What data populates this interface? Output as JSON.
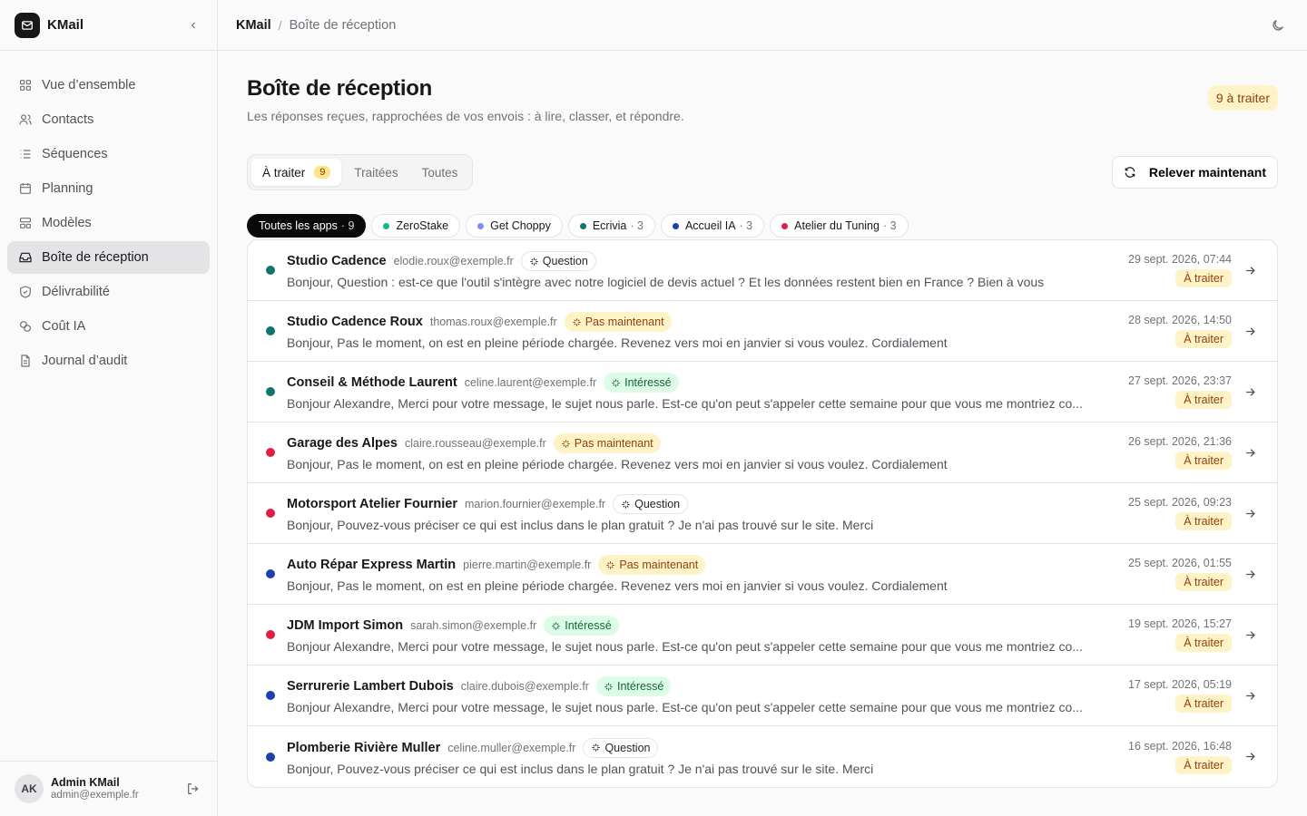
{
  "app": {
    "name": "KMail"
  },
  "sidebar": {
    "items": [
      {
        "label": "Vue d’ensemble",
        "icon": "grid-icon"
      },
      {
        "label": "Contacts",
        "icon": "users-icon"
      },
      {
        "label": "Séquences",
        "icon": "list-icon"
      },
      {
        "label": "Planning",
        "icon": "calendar-icon"
      },
      {
        "label": "Modèles",
        "icon": "template-icon"
      },
      {
        "label": "Boîte de réception",
        "icon": "inbox-icon",
        "active": true
      },
      {
        "label": "Délivrabilité",
        "icon": "shield-icon"
      },
      {
        "label": "Coût IA",
        "icon": "coins-icon"
      },
      {
        "label": "Journal d’audit",
        "icon": "file-icon"
      }
    ],
    "user": {
      "initials": "AK",
      "name": "Admin KMail",
      "email": "admin@exemple.fr"
    }
  },
  "breadcrumb": {
    "root": "KMail",
    "separator": "/",
    "current": "Boîte de réception"
  },
  "header": {
    "title": "Boîte de réception",
    "subtitle": "Les réponses reçues, rapprochées de vos envois : à lire, classer, et répondre.",
    "badge": "9 à traiter"
  },
  "tabs": [
    {
      "label": "À traiter",
      "count": "9",
      "active": true
    },
    {
      "label": "Traitées"
    },
    {
      "label": "Toutes"
    }
  ],
  "refresh_label": "Relever maintenant",
  "filters": [
    {
      "label": "Toutes les apps",
      "count": "· 9",
      "active": true
    },
    {
      "label": "ZeroStake",
      "count": "",
      "color": "#10b981"
    },
    {
      "label": "Get Choppy",
      "count": "",
      "color": "#818cf8"
    },
    {
      "label": "Ecrivia",
      "count": "· 3",
      "color": "#0f766e"
    },
    {
      "label": "Accueil IA",
      "count": "· 3",
      "color": "#1e40af"
    },
    {
      "label": "Atelier du Tuning",
      "count": "· 3",
      "color": "#e11d48"
    }
  ],
  "colors": {
    "teal": "#0f766e",
    "red": "#e11d48",
    "blue": "#1e40af"
  },
  "messages": [
    {
      "sender": "Studio Cadence",
      "email": "elodie.roux@exemple.fr",
      "tag": "Question",
      "tag_type": "question",
      "preview": "Bonjour, Question : est-ce que l'outil s'intègre avec notre logiciel de devis actuel ? Et les données restent bien en France ? Bien à vous",
      "date": "29 sept. 2026, 07:44",
      "status": "À traiter",
      "dot": "#0f766e"
    },
    {
      "sender": "Studio Cadence Roux",
      "email": "thomas.roux@exemple.fr",
      "tag": "Pas maintenant",
      "tag_type": "later",
      "preview": "Bonjour, Pas le moment, on est en pleine période chargée. Revenez vers moi en janvier si vous voulez. Cordialement",
      "date": "28 sept. 2026, 14:50",
      "status": "À traiter",
      "dot": "#0f766e"
    },
    {
      "sender": "Conseil & Méthode Laurent",
      "email": "celine.laurent@exemple.fr",
      "tag": "Intéressé",
      "tag_type": "interest",
      "preview": "Bonjour Alexandre, Merci pour votre message, le sujet nous parle. Est-ce qu'on peut s'appeler cette semaine pour que vous me montriez co...",
      "date": "27 sept. 2026, 23:37",
      "status": "À traiter",
      "dot": "#0f766e"
    },
    {
      "sender": "Garage des Alpes",
      "email": "claire.rousseau@exemple.fr",
      "tag": "Pas maintenant",
      "tag_type": "later",
      "preview": "Bonjour, Pas le moment, on est en pleine période chargée. Revenez vers moi en janvier si vous voulez. Cordialement",
      "date": "26 sept. 2026, 21:36",
      "status": "À traiter",
      "dot": "#e11d48"
    },
    {
      "sender": "Motorsport Atelier Fournier",
      "email": "marion.fournier@exemple.fr",
      "tag": "Question",
      "tag_type": "question",
      "preview": "Bonjour, Pouvez-vous préciser ce qui est inclus dans le plan gratuit ? Je n'ai pas trouvé sur le site. Merci",
      "date": "25 sept. 2026, 09:23",
      "status": "À traiter",
      "dot": "#e11d48"
    },
    {
      "sender": "Auto Répar Express Martin",
      "email": "pierre.martin@exemple.fr",
      "tag": "Pas maintenant",
      "tag_type": "later",
      "preview": "Bonjour, Pas le moment, on est en pleine période chargée. Revenez vers moi en janvier si vous voulez. Cordialement",
      "date": "25 sept. 2026, 01:55",
      "status": "À traiter",
      "dot": "#1e40af"
    },
    {
      "sender": "JDM Import Simon",
      "email": "sarah.simon@exemple.fr",
      "tag": "Intéressé",
      "tag_type": "interest",
      "preview": "Bonjour Alexandre, Merci pour votre message, le sujet nous parle. Est-ce qu'on peut s'appeler cette semaine pour que vous me montriez co...",
      "date": "19 sept. 2026, 15:27",
      "status": "À traiter",
      "dot": "#e11d48"
    },
    {
      "sender": "Serrurerie Lambert Dubois",
      "email": "claire.dubois@exemple.fr",
      "tag": "Intéressé",
      "tag_type": "interest",
      "preview": "Bonjour Alexandre, Merci pour votre message, le sujet nous parle. Est-ce qu'on peut s'appeler cette semaine pour que vous me montriez co...",
      "date": "17 sept. 2026, 05:19",
      "status": "À traiter",
      "dot": "#1e40af"
    },
    {
      "sender": "Plomberie Rivière Muller",
      "email": "celine.muller@exemple.fr",
      "tag": "Question",
      "tag_type": "question",
      "preview": "Bonjour, Pouvez-vous préciser ce qui est inclus dans le plan gratuit ? Je n'ai pas trouvé sur le site. Merci",
      "date": "16 sept. 2026, 16:48",
      "status": "À traiter",
      "dot": "#1e40af"
    }
  ]
}
